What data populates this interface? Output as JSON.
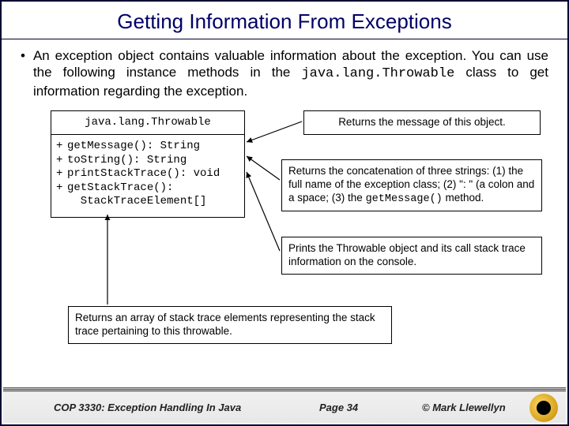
{
  "title": "Getting Information From Exceptions",
  "bullet": {
    "pre": "An exception object contains valuable information about the exception. You can use the following instance methods in the ",
    "mono": "java.lang.Throwable",
    "post": " class to get information regarding the exception."
  },
  "uml": {
    "header": "java.lang.Throwable",
    "rows": [
      {
        "plus": "+",
        "sig": "getMessage(): String"
      },
      {
        "plus": "+",
        "sig": "toString(): String"
      },
      {
        "plus": "+",
        "sig": "printStackTrace(): void"
      },
      {
        "plus": "+",
        "sig": "getStackTrace():"
      },
      {
        "plus": "",
        "sig": "  StackTraceElement[]"
      }
    ]
  },
  "desc1": "Returns the message of this object.",
  "desc2": {
    "pre": "Returns the concatenation of three strings: (1) the full name of the exception class; (2) \": \" (a colon and a space; (3) the ",
    "mono": "getMessage()",
    "post": " method."
  },
  "desc3": "Prints the Throwable object and its call stack trace information on the console.",
  "desc4": "Returns an array of stack trace elements representing the stack trace pertaining to this throwable.",
  "footer": {
    "course": "COP 3330:  Exception Handling In Java",
    "page": "Page 34",
    "copyright": "© Mark Llewellyn"
  }
}
